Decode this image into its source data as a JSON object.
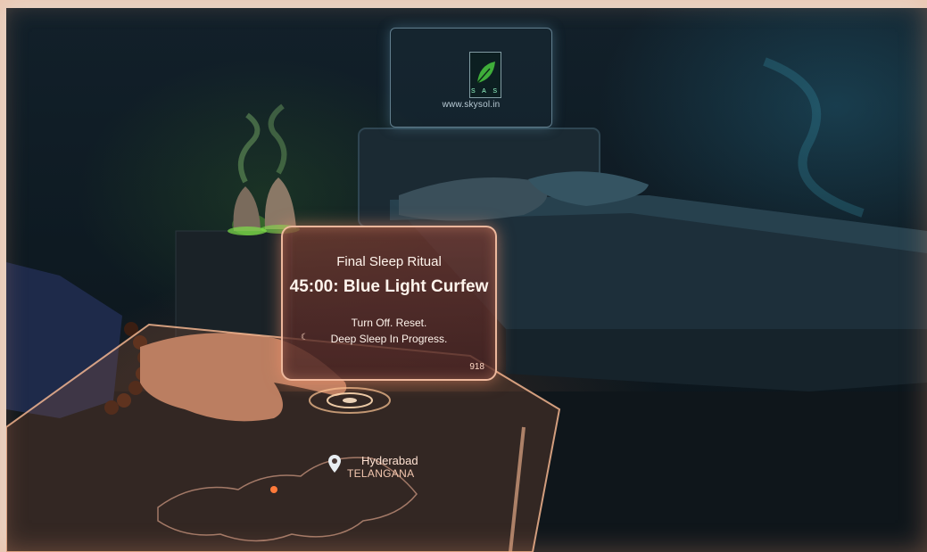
{
  "sign": {
    "letters": "S A S",
    "url": "www.skysol.in"
  },
  "panel": {
    "title": "Final Sleep Ritual",
    "headline": "45:00: Blue Light Curfew",
    "line1": "Turn Off. Reset.",
    "line2": "Deep Sleep In Progress.",
    "number": "918"
  },
  "map": {
    "city": "Hyderabad",
    "state": "TELANGANA"
  },
  "colors": {
    "panel_glow": "#ff9a70",
    "ambient_teal": "#2f8aa6",
    "diffuser_green": "#6fcf3a"
  }
}
